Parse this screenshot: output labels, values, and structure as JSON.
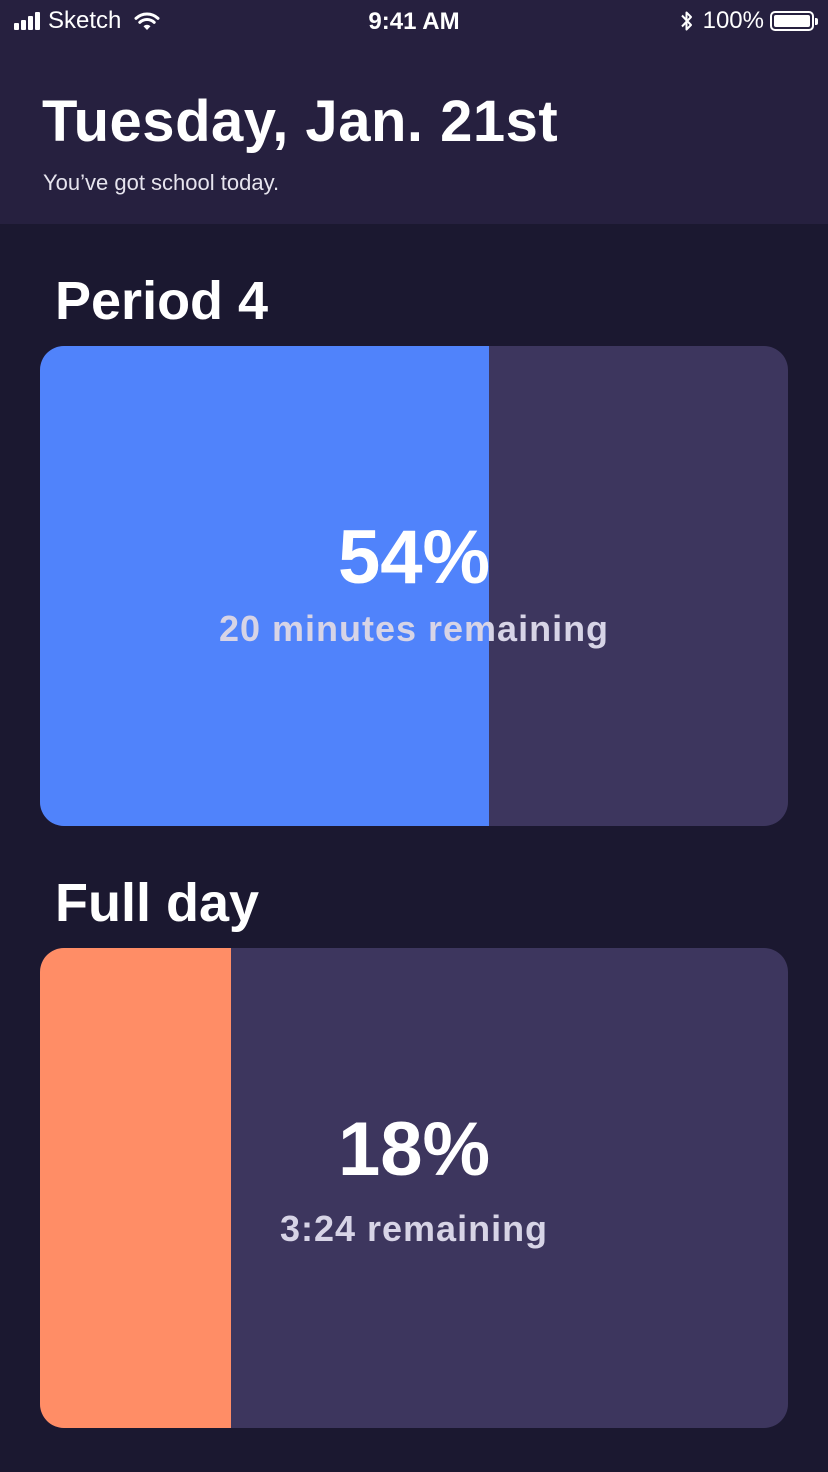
{
  "status_bar": {
    "carrier": "Sketch",
    "time": "9:41 AM",
    "battery": "100%"
  },
  "header": {
    "title": "Tuesday, Jan. 21st",
    "subtitle": "You’ve got school today."
  },
  "cards": [
    {
      "title": "Period 4",
      "percent_label": "54%",
      "progress": 0.6,
      "caption": "20 minutes remaining",
      "fill_color": "#5083fb"
    },
    {
      "title": "Full day",
      "percent_label": "18%",
      "progress": 0.255,
      "caption": "3:24 remaining",
      "fill_color": "#ff8d66"
    }
  ],
  "colors": {
    "background": "#1b1830",
    "header": "#26203f",
    "card_track": "#3d365e"
  }
}
